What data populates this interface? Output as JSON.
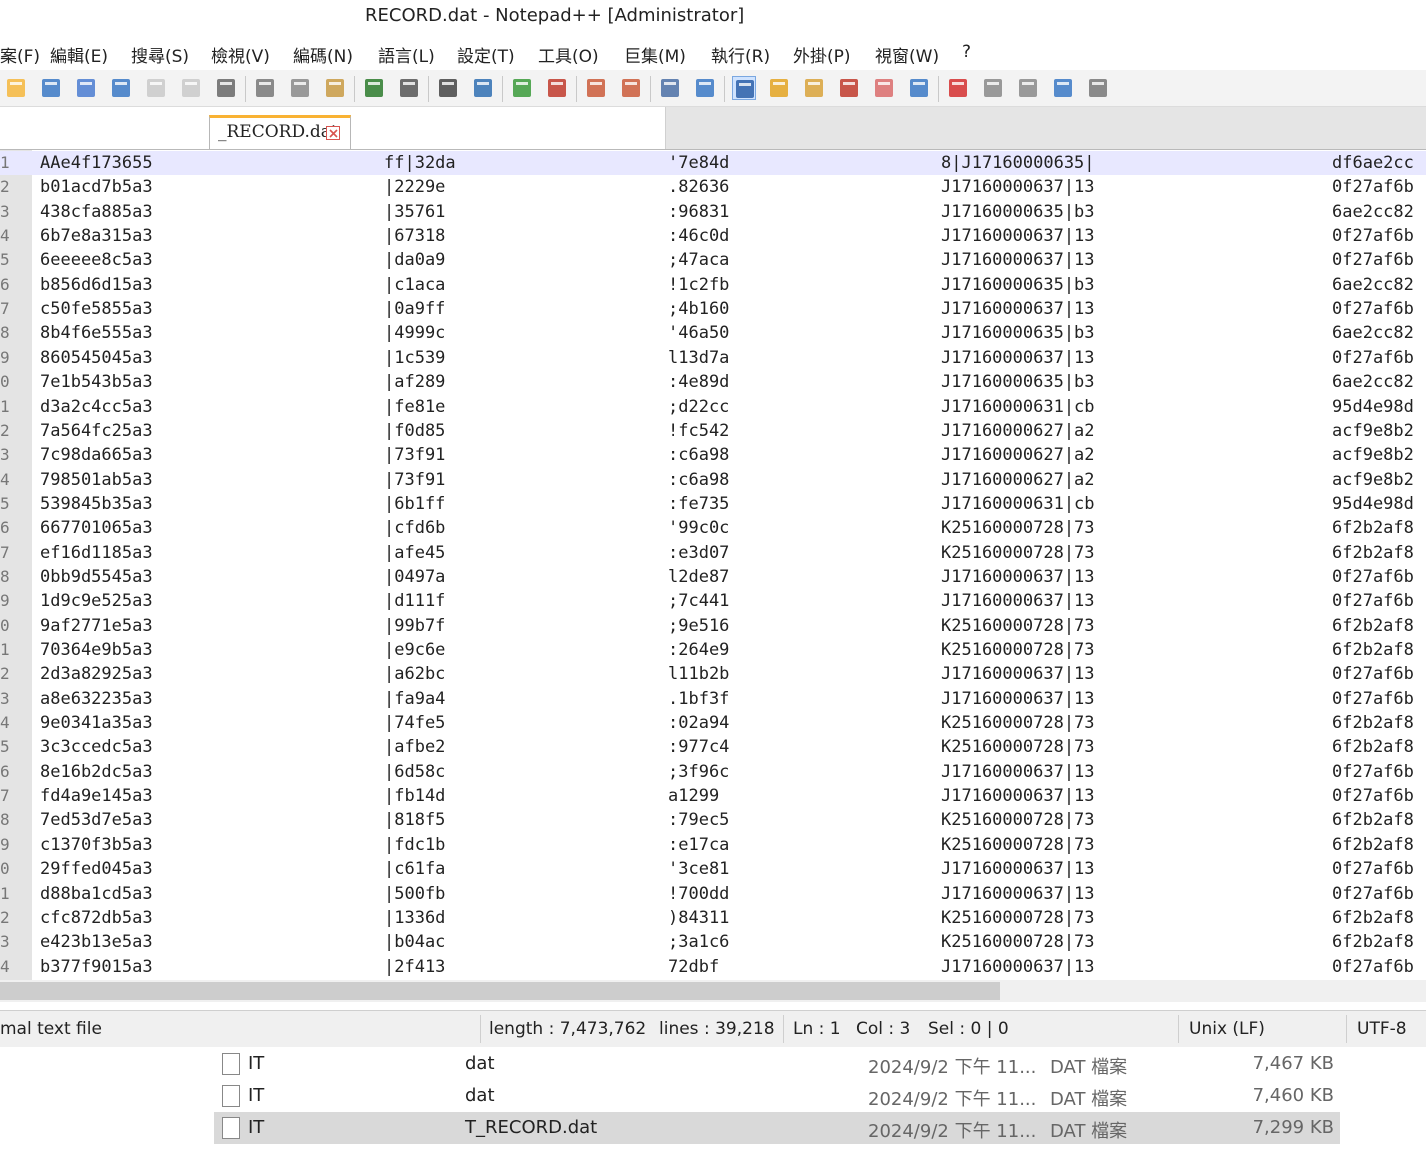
{
  "window": {
    "title": "RECORD.dat - Notepad++ [Administrator]"
  },
  "menu": [
    "案(F)",
    "編輯(E)",
    "搜尋(S)",
    "檢視(V)",
    "編碼(N)",
    "語言(L)",
    "設定(T)",
    "工具(O)",
    "巨集(M)",
    "執行(R)",
    "外掛(P)",
    "視窗(W)",
    "?"
  ],
  "toolbar": {
    "icons": [
      "new-file-icon",
      "open-file-icon",
      "save-icon",
      "save-all-icon",
      "close-icon",
      "close-all-icon",
      "print-icon",
      "cut-icon",
      "copy-icon",
      "paste-icon",
      "undo-icon",
      "redo-icon",
      "find-icon",
      "replace-icon",
      "zoom-in-icon",
      "zoom-out-icon",
      "sync-vertical-icon",
      "sync-horizontal-icon",
      "word-wrap-icon",
      "show-all-chars-icon",
      "indent-guide-icon",
      "user-language-icon",
      "doc-map-icon",
      "function-list-icon",
      "folder-workspace-icon",
      "monitoring-icon",
      "macro-record-icon",
      "macro-stop-icon",
      "macro-play-icon",
      "macro-run-multiple-icon",
      "macro-save-icon"
    ]
  },
  "tab": {
    "label": "_RECORD.dat"
  },
  "editor": {
    "lines": [
      {
        "n": "1",
        "a": "AAe4f173655",
        "b": "ff|32da",
        "c": "'7e84d",
        "d": "8|J17160000635|",
        "e": "df6ae2cc"
      },
      {
        "n": "2",
        "a": "b01acd7b5a3",
        "b": "|2229e",
        "c": ".82636",
        "d": "J17160000637|13",
        "e": "0f27af6b"
      },
      {
        "n": "3",
        "a": "438cfa885a3",
        "b": "|35761",
        "c": ":96831",
        "d": "J17160000635|b3",
        "e": "6ae2cc82"
      },
      {
        "n": "4",
        "a": "6b7e8a315a3",
        "b": "|67318",
        "c": ":46c0d",
        "d": "J17160000637|13",
        "e": "0f27af6b"
      },
      {
        "n": "5",
        "a": "6eeeee8c5a3",
        "b": "|da0a9",
        "c": ";47aca",
        "d": "J17160000637|13",
        "e": "0f27af6b"
      },
      {
        "n": "6",
        "a": "b856d6d15a3",
        "b": "|c1aca",
        "c": "!1c2fb",
        "d": "J17160000635|b3",
        "e": "6ae2cc82"
      },
      {
        "n": "7",
        "a": "c50fe5855a3",
        "b": "|0a9ff",
        "c": ";4b160",
        "d": "J17160000637|13",
        "e": "0f27af6b"
      },
      {
        "n": "8",
        "a": "8b4f6e555a3",
        "b": "|4999c",
        "c": "'46a50",
        "d": "J17160000635|b3",
        "e": "6ae2cc82"
      },
      {
        "n": "9",
        "a": "860545045a3",
        "b": "|1c539",
        "c": "l13d7a",
        "d": "J17160000637|13",
        "e": "0f27af6b"
      },
      {
        "n": "0",
        "a": "7e1b543b5a3",
        "b": "|af289",
        "c": ":4e89d",
        "d": "J17160000635|b3",
        "e": "6ae2cc82"
      },
      {
        "n": "1",
        "a": "d3a2c4cc5a3",
        "b": "|fe81e",
        "c": ";d22cc",
        "d": "J17160000631|cb",
        "e": "95d4e98d"
      },
      {
        "n": "2",
        "a": "7a564fc25a3",
        "b": "|f0d85",
        "c": "!fc542",
        "d": "J17160000627|a2",
        "e": "acf9e8b2"
      },
      {
        "n": "3",
        "a": "7c98da665a3",
        "b": "|73f91",
        "c": ":c6a98",
        "d": "J17160000627|a2",
        "e": "acf9e8b2"
      },
      {
        "n": "4",
        "a": "798501ab5a3",
        "b": "|73f91",
        "c": ":c6a98",
        "d": "J17160000627|a2",
        "e": "acf9e8b2"
      },
      {
        "n": "5",
        "a": "539845b35a3",
        "b": "|6b1ff",
        "c": ":fe735",
        "d": "J17160000631|cb",
        "e": "95d4e98d"
      },
      {
        "n": "6",
        "a": "667701065a3",
        "b": "|cfd6b",
        "c": "'99c0c",
        "d": "K25160000728|73",
        "e": "6f2b2af8"
      },
      {
        "n": "7",
        "a": "ef16d1185a3",
        "b": "|afe45",
        "c": ":e3d07",
        "d": "K25160000728|73",
        "e": "6f2b2af8"
      },
      {
        "n": "8",
        "a": "0bb9d5545a3",
        "b": "|0497a",
        "c": "l2de87",
        "d": "J17160000637|13",
        "e": "0f27af6b"
      },
      {
        "n": "9",
        "a": "1d9c9e525a3",
        "b": "|d111f",
        "c": ";7c441",
        "d": "J17160000637|13",
        "e": "0f27af6b"
      },
      {
        "n": "0",
        "a": "9af2771e5a3",
        "b": "|99b7f",
        "c": ";9e516",
        "d": "K25160000728|73",
        "e": "6f2b2af8"
      },
      {
        "n": "1",
        "a": "70364e9b5a3",
        "b": "|e9c6e",
        "c": ":264e9",
        "d": "K25160000728|73",
        "e": "6f2b2af8"
      },
      {
        "n": "2",
        "a": "2d3a82925a3",
        "b": "|a62bc",
        "c": "l11b2b",
        "d": "J17160000637|13",
        "e": "0f27af6b"
      },
      {
        "n": "3",
        "a": "a8e632235a3",
        "b": "|fa9a4",
        "c": ".1bf3f",
        "d": "J17160000637|13",
        "e": "0f27af6b"
      },
      {
        "n": "4",
        "a": "9e0341a35a3",
        "b": "|74fe5",
        "c": ":02a94",
        "d": "K25160000728|73",
        "e": "6f2b2af8"
      },
      {
        "n": "5",
        "a": "3c3ccedc5a3",
        "b": "|afbe2",
        "c": ":977c4",
        "d": "K25160000728|73",
        "e": "6f2b2af8"
      },
      {
        "n": "6",
        "a": "8e16b2dc5a3",
        "b": "|6d58c",
        "c": ";3f96c",
        "d": "J17160000637|13",
        "e": "0f27af6b"
      },
      {
        "n": "7",
        "a": "fd4a9e145a3",
        "b": "|fb14d",
        "c": "a1299",
        "d": "J17160000637|13",
        "e": "0f27af6b"
      },
      {
        "n": "8",
        "a": "7ed53d7e5a3",
        "b": "|818f5",
        "c": ":79ec5",
        "d": "K25160000728|73",
        "e": "6f2b2af8"
      },
      {
        "n": "9",
        "a": "c1370f3b5a3",
        "b": "|fdc1b",
        "c": ":e17ca",
        "d": "K25160000728|73",
        "e": "6f2b2af8"
      },
      {
        "n": "0",
        "a": "29ffed045a3",
        "b": "|c61fa",
        "c": "'3ce81",
        "d": "J17160000637|13",
        "e": "0f27af6b"
      },
      {
        "n": "1",
        "a": "d88ba1cd5a3",
        "b": "|500fb",
        "c": "!700dd",
        "d": "J17160000637|13",
        "e": "0f27af6b"
      },
      {
        "n": "2",
        "a": "cfc872db5a3",
        "b": "|1336d",
        "c": ")84311",
        "d": "K25160000728|73",
        "e": "6f2b2af8"
      },
      {
        "n": "3",
        "a": "e423b13e5a3",
        "b": "|b04ac",
        "c": ";3a1c6",
        "d": "K25160000728|73",
        "e": "6f2b2af8"
      },
      {
        "n": "4",
        "a": "b377f9015a3",
        "b": "|2f413",
        "c": "72dbf",
        "d": "J17160000637|13",
        "e": "0f27af6b"
      }
    ]
  },
  "status": {
    "filetype": "mal text file",
    "length": "length : 7,473,762",
    "lines": "lines : 39,218",
    "ln": "Ln : 1",
    "col": "Col : 3",
    "sel": "Sel : 0 | 0",
    "eol": "Unix (LF)",
    "encoding": "UTF-8"
  },
  "explorer": {
    "rows": [
      {
        "n1": "IT",
        "n2": "dat",
        "date": "2024/9/2 下午 11...",
        "type": "DAT 檔案",
        "size": "7,467 KB",
        "selected": false
      },
      {
        "n1": "IT",
        "n2": "dat",
        "date": "2024/9/2 下午 11...",
        "type": "DAT 檔案",
        "size": "7,460 KB",
        "selected": false
      },
      {
        "n1": "IT",
        "n2": "T_RECORD.dat",
        "date": "2024/9/2 下午 11...",
        "type": "DAT 檔案",
        "size": "7,299 KB",
        "selected": true
      }
    ]
  }
}
